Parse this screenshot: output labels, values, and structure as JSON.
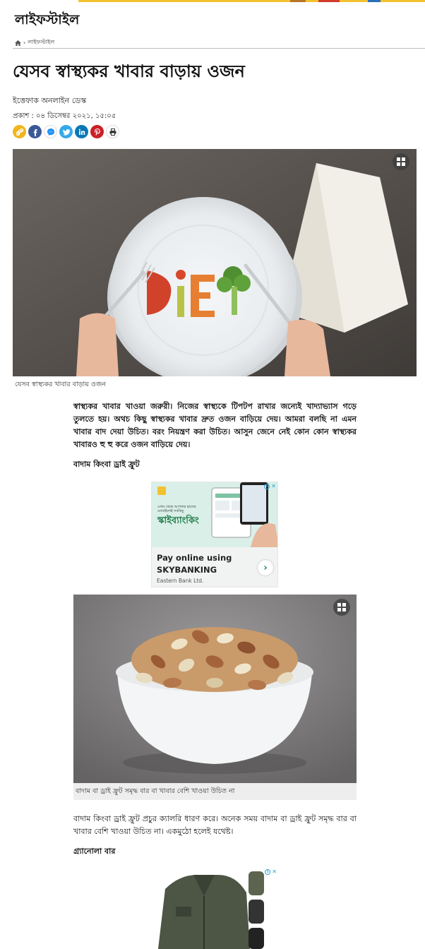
{
  "site": {
    "section_title": "লাইফস্টাইল"
  },
  "breadcrumb": {
    "home_icon": "home-icon",
    "separator": "›",
    "current": "লাইফস্টাইল"
  },
  "article": {
    "headline": "যেসব স্বাস্থ্যকর খাবার বাড়ায় ওজন",
    "author": "ইত্তেফাক অনলাইন ডেস্ক",
    "published": "প্রকাশ : ০৪ ডিসেম্বর ২০২১, ১৫:০৫",
    "share_buttons": [
      {
        "name": "copy-link-icon",
        "color": "#f0b51d"
      },
      {
        "name": "facebook-icon",
        "color": "#3b5998"
      },
      {
        "name": "messenger-icon",
        "color": "#1d8ff2"
      },
      {
        "name": "twitter-icon",
        "color": "#35a9e8"
      },
      {
        "name": "linkedin-icon",
        "color": "#0a77b5"
      },
      {
        "name": "pinterest-icon",
        "color": "#cb2027"
      },
      {
        "name": "print-icon",
        "color": "#555555"
      }
    ],
    "hero_image": {
      "word_on_plate": "DiET",
      "caption": "যেসব স্বাস্থ্যকর খাবার বাড়ায় ওজন",
      "gallery_icon": "gallery-icon"
    },
    "intro": "স্বাস্থ্যকর খাবার খাওয়া জরুরী। নিজের স্বাস্থ্যকে টিপটপ রাখার জন্যেই খাদ্যাভ্যাস গড়ে তুলতে হয়। অথচ কিছু স্বাস্থ্যকর খাবার দ্রুত ওজন বাড়িয়ে দেয়। আমরা বলছি না এমন খাবার বাদ দেয়া উচিত। বরং নিয়ন্ত্রণ করা উচিত। আসুন জেনে নেই কোন কোন স্বাস্থ্যকর খাবারও হু হু করে ওজন বাড়িয়ে দেয়।",
    "subheading_1": "বাদাম কিংবা ড্রাই ফ্রুট",
    "nuts_image": {
      "caption": "বাদাম বা ড্রাই ফ্রুট সমৃদ্ধ বার বা খাবার বেশি খাওয়া উচিত না",
      "gallery_icon": "gallery-icon"
    },
    "paragraph_2": "বাদাম কিংবা ড্রাই ফ্রুট প্রচুর ক্যালরি ধারণ করে। অনেক সময় বাদাম বা ড্রাই ফ্রুট সমৃদ্ধ বার বা খাবার বেশি খাওয়া উচিত না। একমুঠো হলেই যথেষ্ট।",
    "subheading_2": "গ্র্যানোলা বার"
  },
  "ads": {
    "ad_1": {
      "headline_small": "এখন থেকে আপনার হাতের মোবাইলেই সবকিছু",
      "brand_bangla": "স্কাইব্যাংকিং",
      "pay_text": "Pay online using SKYBANKING",
      "advertiser": "Eastern Bank Ltd.",
      "info_label": "i",
      "close_label": "✕",
      "go_label": "›"
    },
    "ad_2": {
      "info_label": "i",
      "close_label": "✕"
    }
  },
  "colors": {
    "banner": "#f2c230",
    "rule": "#bdbdbd",
    "caption_bg": "#eeeeee",
    "ad_green": "#1c7a45"
  }
}
